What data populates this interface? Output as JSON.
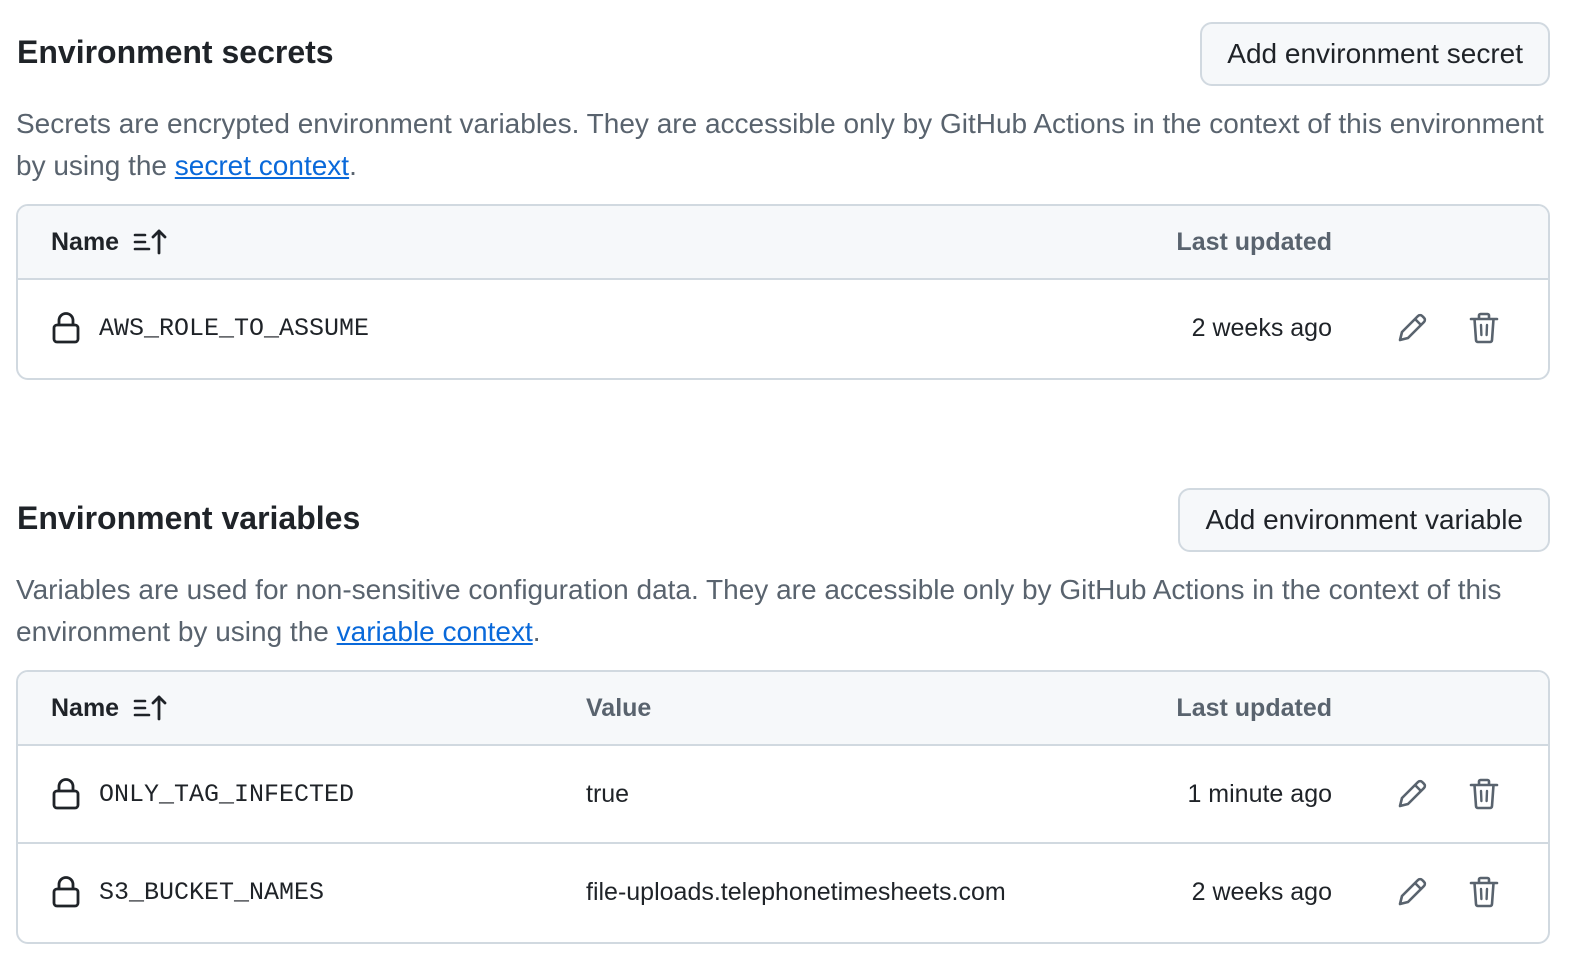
{
  "secrets": {
    "title": "Environment secrets",
    "add_button": "Add environment secret",
    "desc_prefix": "Secrets are encrypted environment variables. They are accessible only by GitHub Actions in the context of this environment by using the ",
    "desc_link": "secret context",
    "desc_suffix": ".",
    "columns": {
      "name": "Name",
      "last_updated": "Last updated"
    },
    "rows": [
      {
        "name": "AWS_ROLE_TO_ASSUME",
        "updated": "2 weeks ago"
      }
    ]
  },
  "variables": {
    "title": "Environment variables",
    "add_button": "Add environment variable",
    "desc_prefix": "Variables are used for non-sensitive configuration data. They are accessible only by GitHub Actions in the context of this environment by using the ",
    "desc_link": "variable context",
    "desc_suffix": ".",
    "columns": {
      "name": "Name",
      "value": "Value",
      "last_updated": "Last updated"
    },
    "rows": [
      {
        "name": "ONLY_TAG_INFECTED",
        "value": "true",
        "updated": "1 minute ago"
      },
      {
        "name": "S3_BUCKET_NAMES",
        "value": "file-uploads.telephonetimesheets.com",
        "updated": "2 weeks ago"
      }
    ]
  },
  "icons": {
    "sort": "sort-ascending-icon",
    "lock": "lock-icon",
    "edit": "pencil-icon",
    "delete": "trash-icon"
  },
  "colors": {
    "link": "#0969da",
    "muted_text": "#59636e",
    "border": "#d1d9e0",
    "header_bg": "#f6f8fa"
  }
}
